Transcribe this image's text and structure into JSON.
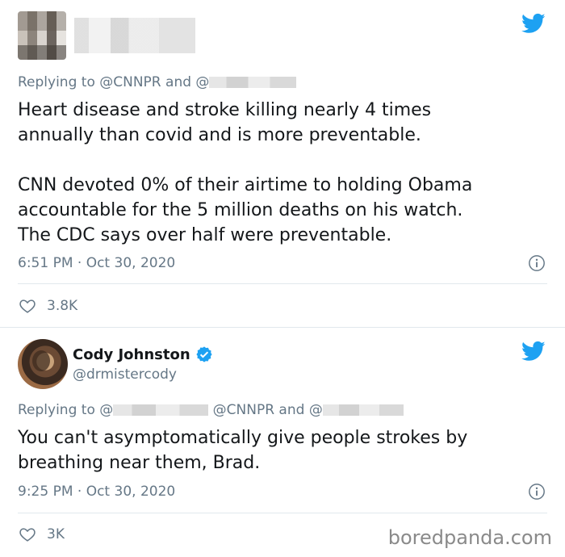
{
  "tweet1": {
    "reply": {
      "prefix": "Replying to ",
      "mention1": "@CNNPR",
      "and": " and ",
      "mention2_prefix": "@"
    },
    "text": "Heart disease and stroke killing nearly 4 times\nannually than covid and is more preventable.\n\nCNN devoted 0% of their airtime to holding Obama\naccountable for the 5 million deaths on his watch.\nThe CDC says over half were preventable.",
    "timestamp": "6:51 PM · Oct 30, 2020",
    "likes": "3.8K",
    "icons": {
      "bird": "twitter-bird-icon",
      "info": "info-icon",
      "heart": "heart-icon"
    }
  },
  "tweet2": {
    "author": {
      "name": "Cody Johnston",
      "handle": "@drmistercody"
    },
    "reply": {
      "prefix": "Replying to ",
      "mention_start": "@",
      "mention2": "@CNNPR",
      "and": " and ",
      "mention3_prefix": "@"
    },
    "text": "You can't asymptomatically give people strokes by\nbreathing near them, Brad.",
    "timestamp": "9:25 PM · Oct 30, 2020",
    "likes": "3K",
    "icons": {
      "bird": "twitter-bird-icon",
      "verified": "verified-badge-icon",
      "info": "info-icon",
      "heart": "heart-icon"
    }
  },
  "watermark": "boredpanda.com",
  "colors": {
    "twitter_blue": "#1da1f2",
    "muted": "#657786",
    "text": "#14171a",
    "divider": "#e1e8ed"
  }
}
